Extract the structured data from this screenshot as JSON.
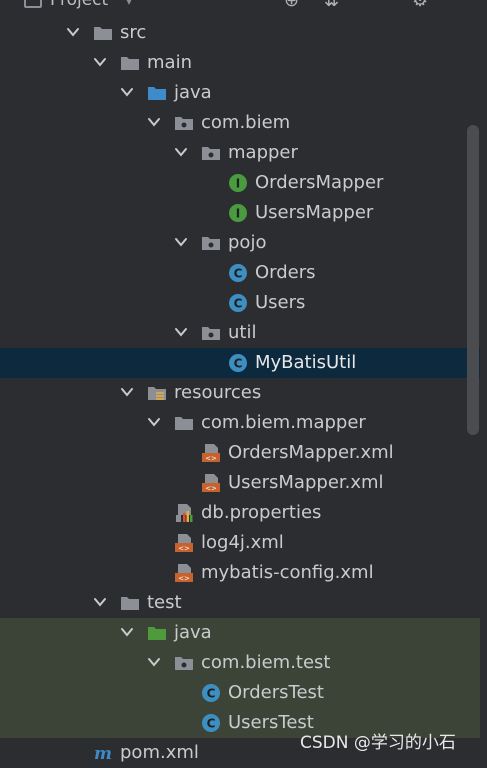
{
  "header": {
    "title": "Project"
  },
  "tree": [
    {
      "label": "src",
      "level": 0,
      "icon": "folder-icon",
      "expanded": true
    },
    {
      "label": "main",
      "level": 1,
      "icon": "folder-icon",
      "expanded": true
    },
    {
      "label": "java",
      "level": 2,
      "icon": "source-folder-icon",
      "expanded": true
    },
    {
      "label": "com.biem",
      "level": 3,
      "icon": "package-icon",
      "expanded": true
    },
    {
      "label": "mapper",
      "level": 4,
      "icon": "package-icon",
      "expanded": true
    },
    {
      "label": "OrdersMapper",
      "level": 5,
      "icon": "interface-icon"
    },
    {
      "label": "UsersMapper",
      "level": 5,
      "icon": "interface-icon"
    },
    {
      "label": "pojo",
      "level": 4,
      "icon": "package-icon",
      "expanded": true
    },
    {
      "label": "Orders",
      "level": 5,
      "icon": "class-icon"
    },
    {
      "label": "Users",
      "level": 5,
      "icon": "class-icon"
    },
    {
      "label": "util",
      "level": 4,
      "icon": "package-icon",
      "expanded": true
    },
    {
      "label": "MyBatisUtil",
      "level": 5,
      "icon": "class-icon",
      "selected": true
    },
    {
      "label": "resources",
      "level": 2,
      "icon": "resources-folder-icon",
      "expanded": true
    },
    {
      "label": "com.biem.mapper",
      "level": 3,
      "icon": "folder-icon",
      "expanded": true
    },
    {
      "label": "OrdersMapper.xml",
      "level": 4,
      "icon": "xml-file-icon"
    },
    {
      "label": "UsersMapper.xml",
      "level": 4,
      "icon": "xml-file-icon"
    },
    {
      "label": "db.properties",
      "level": 3,
      "icon": "properties-file-icon"
    },
    {
      "label": "log4j.xml",
      "level": 3,
      "icon": "xml-file-icon"
    },
    {
      "label": "mybatis-config.xml",
      "level": 3,
      "icon": "xml-file-icon"
    },
    {
      "label": "test",
      "level": 1,
      "icon": "folder-icon",
      "expanded": true
    },
    {
      "label": "java",
      "level": 2,
      "icon": "test-source-folder-icon",
      "expanded": true,
      "test_bg": true
    },
    {
      "label": "com.biem.test",
      "level": 3,
      "icon": "package-icon",
      "expanded": true,
      "test_bg": true
    },
    {
      "label": "OrdersTest",
      "level": 4,
      "icon": "class-icon",
      "test_bg": true
    },
    {
      "label": "UsersTest",
      "level": 4,
      "icon": "class-icon",
      "test_bg": true
    },
    {
      "label": "pom.xml",
      "level": 0,
      "icon": "maven-icon",
      "partial": true
    }
  ],
  "colors": {
    "background": "#2b2d30",
    "selection": "#0d293e",
    "test_highlight": "#3c4437",
    "interface_icon": "#4a9a3f",
    "class_icon": "#3c8fc0",
    "folder_icon": "#8c9096",
    "source_folder_icon": "#3d8bc9",
    "test_folder_icon": "#4f9a3a",
    "xml_icon": "#c5622e"
  },
  "watermark": "CSDN @学习的小石"
}
